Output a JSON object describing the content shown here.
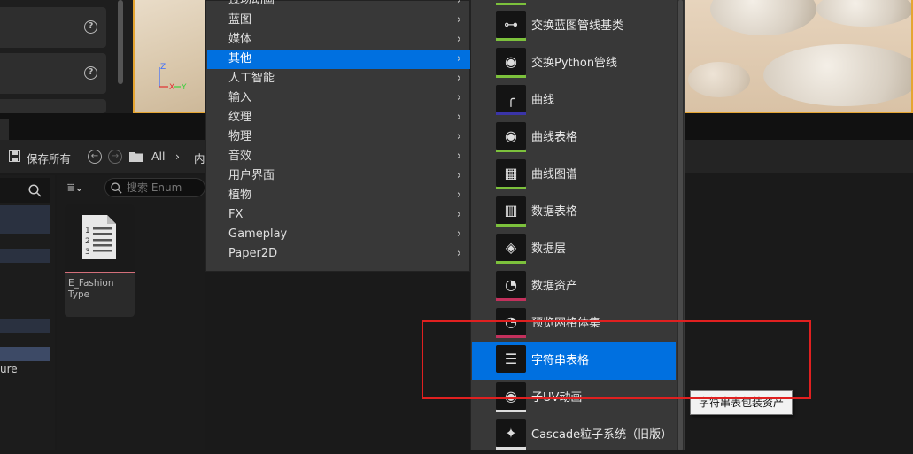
{
  "toolbar": {
    "save_all_label": "保存所有",
    "path_root": "All",
    "path_next": "内"
  },
  "search": {
    "placeholder": "搜索 Enum"
  },
  "asset": {
    "name_line1": "E_Fashion",
    "name_line2": "Type"
  },
  "sources": {
    "truncated_label": "ure"
  },
  "menu": {
    "items": [
      {
        "label": "过场动画"
      },
      {
        "label": "蓝图"
      },
      {
        "label": "媒体"
      },
      {
        "label": "其他",
        "selected": true
      },
      {
        "label": "人工智能"
      },
      {
        "label": "输入"
      },
      {
        "label": "纹理"
      },
      {
        "label": "物理"
      },
      {
        "label": "音效"
      },
      {
        "label": "用户界面"
      },
      {
        "label": "植物"
      },
      {
        "label": "FX"
      },
      {
        "label": "Gameplay"
      },
      {
        "label": "Paper2D"
      }
    ]
  },
  "submenu": {
    "items": [
      {
        "label": "交换蓝图管线基类",
        "icon": "pipeline-nodes-icon",
        "strip": "#7cc13c"
      },
      {
        "label": "交换Python管线",
        "icon": "python-pipeline-icon",
        "strip": "#7cc13c"
      },
      {
        "label": "曲线",
        "icon": "curve-icon",
        "strip": "#3a34a8"
      },
      {
        "label": "曲线表格",
        "icon": "curve-table-icon",
        "strip": "#7cc13c"
      },
      {
        "label": "曲线图谱",
        "icon": "curve-atlas-icon",
        "strip": "#7cc13c"
      },
      {
        "label": "数据表格",
        "icon": "data-table-icon",
        "strip": "#7cc13c"
      },
      {
        "label": "数据层",
        "icon": "data-layer-icon",
        "strip": "#7cc13c"
      },
      {
        "label": "数据资产",
        "icon": "data-asset-icon",
        "strip": "#c3305c"
      },
      {
        "label": "预览网格体集",
        "icon": "preview-mesh-icon",
        "strip": "#c3305c"
      },
      {
        "label": "字符串表格",
        "icon": "string-table-icon",
        "strip": "#0070e0",
        "selected": true
      },
      {
        "label": "子UV动画",
        "icon": "sub-uv-icon",
        "strip": "#dddddd"
      },
      {
        "label": "Cascade粒子系统（旧版）",
        "icon": "particle-icon",
        "strip": "#dddddd"
      }
    ]
  },
  "tooltip": {
    "text": "字符串表包装资产"
  },
  "colors": {
    "accent": "#0070e0",
    "highlight_box": "#e02020",
    "viewport_border": "#e5a532"
  }
}
